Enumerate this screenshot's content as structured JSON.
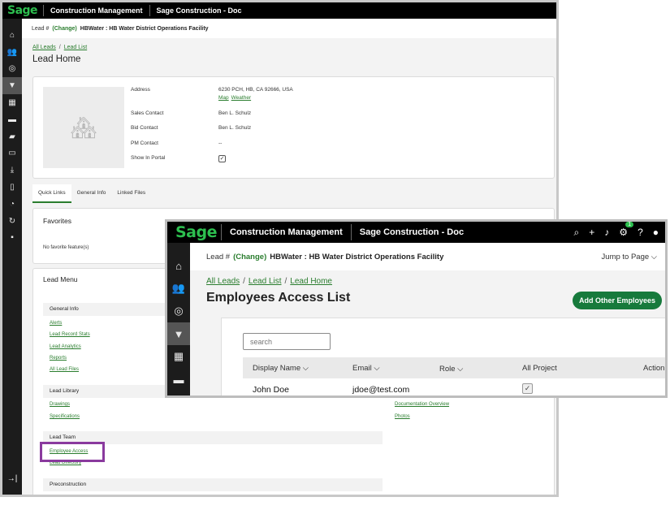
{
  "back_window": {
    "topbar": {
      "logo": "Sage",
      "module": "Construction Management",
      "app": "Sage Construction - Doc"
    },
    "sidebar_icons": [
      "home-icon",
      "users-icon",
      "coins-icon",
      "filter-icon",
      "building-icon",
      "truck-icon",
      "delivery-icon",
      "id-card-icon",
      "download-icon",
      "document-icon",
      "pie-chart-icon",
      "sync-icon",
      "chat-icon"
    ],
    "exit_icon": "→|",
    "leadbar": {
      "prefix": "Lead #",
      "change": "(Change)",
      "project": "HBWater : HB Water District Operations Facility"
    },
    "breadcrumbs": [
      "All Leads",
      "Lead List"
    ],
    "title": "Lead Home",
    "info": {
      "address_label": "Address",
      "address_value": "6230 PCH, HB, CA 92666, USA",
      "map_link": "Map",
      "weather_link": "Weather",
      "sales_label": "Sales Contact",
      "sales_value": "Ben L. Schulz",
      "bid_label": "Bid Contact",
      "bid_value": "Ben L. Schulz",
      "pm_label": "PM Contact",
      "pm_value": "--",
      "portal_label": "Show In Portal",
      "portal_check": "✓"
    },
    "tabs": [
      "Quick Links",
      "General Info",
      "Linked Files"
    ],
    "favorites": {
      "title": "Favorites",
      "empty": "No favorite feature(s)"
    },
    "lead_menu": {
      "title": "Lead Menu",
      "general_head": "General Info",
      "general_links": [
        "Alerts",
        "Lead Record Stats",
        "Lead Analytics",
        "Reports",
        "All Lead Files"
      ],
      "library_head": "Lead Library",
      "library_links": [
        "Drawings",
        "Specifications"
      ],
      "library_right_links": [
        "Documentation Overview",
        "Photos"
      ],
      "team_head": "Lead Team",
      "team_links": [
        "Employee Access",
        "Lead Directory"
      ],
      "precon_head": "Preconstruction"
    }
  },
  "front_window": {
    "topbar": {
      "logo": "Sage",
      "module": "Construction Management",
      "app": "Sage Construction - Doc",
      "notif_count": "1"
    },
    "sidebar_icons": [
      "home-icon",
      "users-icon",
      "coins-icon",
      "filter-icon",
      "building-icon",
      "truck-icon"
    ],
    "leadbar": {
      "prefix": "Lead #",
      "change": "(Change)",
      "project": "HBWater : HB Water District Operations Facility",
      "jump": "Jump to Page ⌵"
    },
    "breadcrumbs": [
      "All Leads",
      "Lead List",
      "Lead Home"
    ],
    "title": "Employees Access List",
    "add_button": "Add Other Employees",
    "search_placeholder": "search",
    "columns": [
      "Display Name ⌵",
      "Email ⌵",
      "Role ⌵",
      "All Project",
      "Action"
    ],
    "rows": [
      {
        "name": "John Doe",
        "email": "jdoe@test.com",
        "all_project": "✓"
      }
    ]
  }
}
